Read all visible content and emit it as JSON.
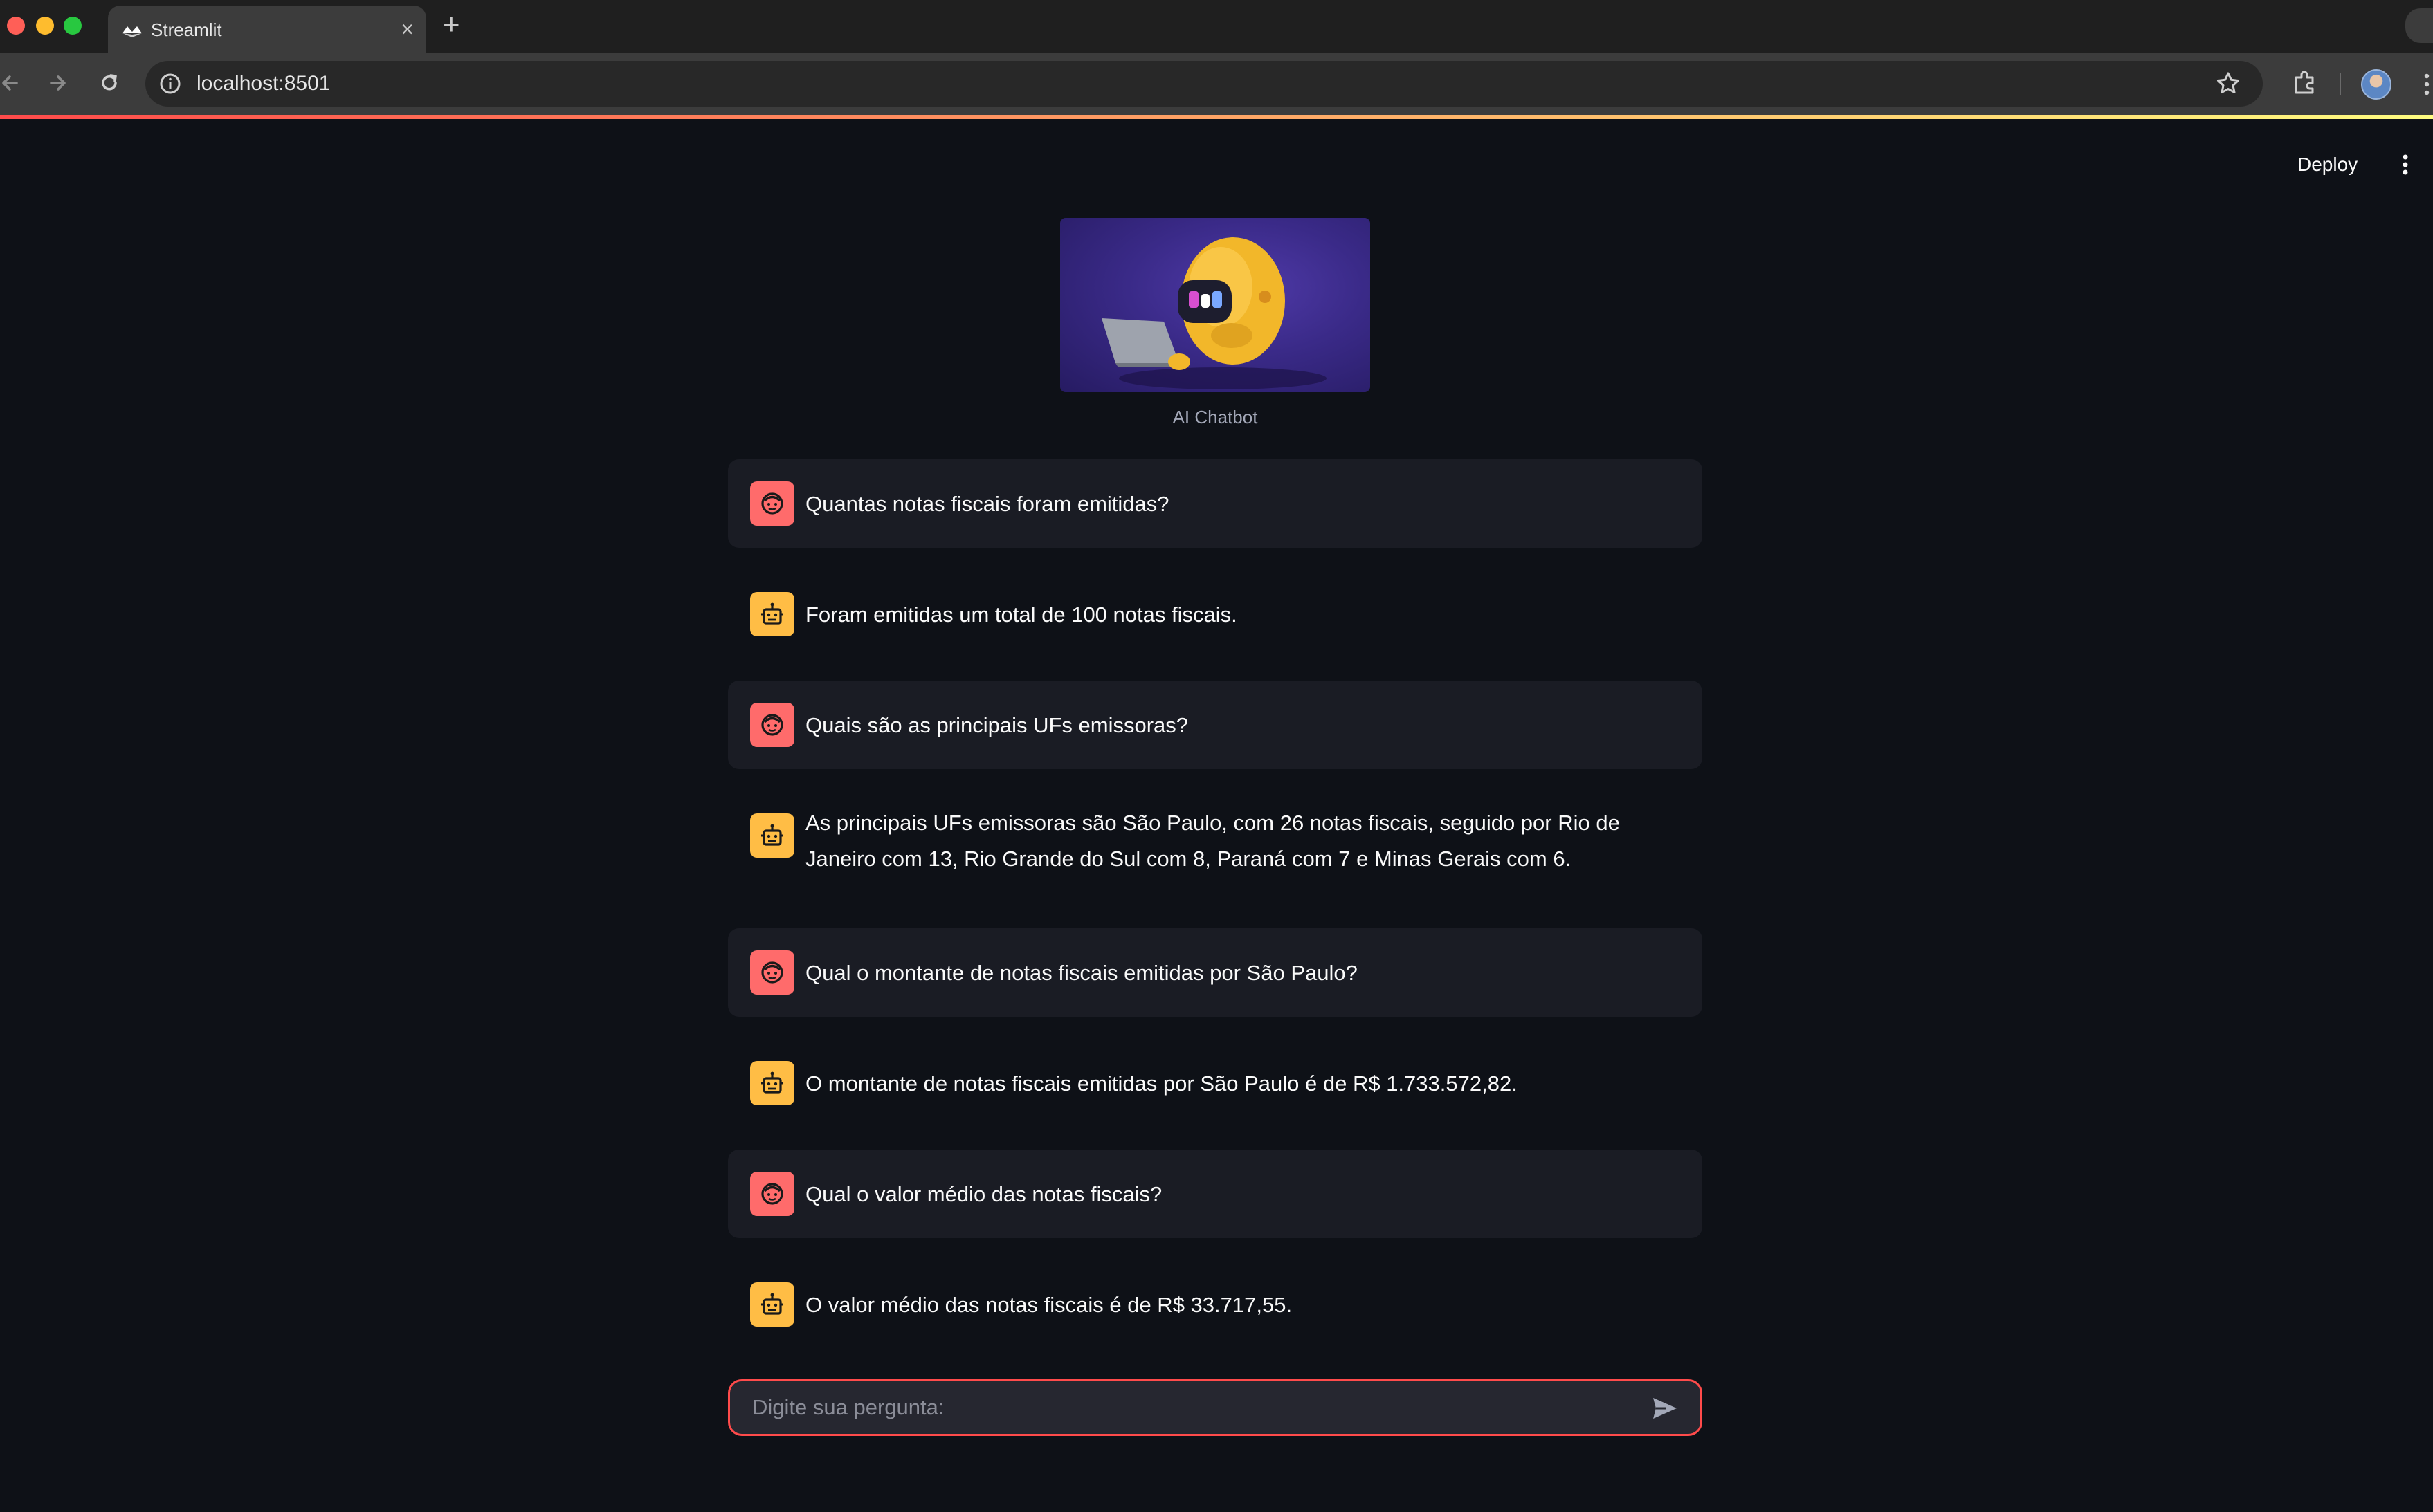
{
  "browser": {
    "tab_title": "Streamlit",
    "tab_close": "×",
    "new_tab": "+",
    "url": "localhost:8501"
  },
  "app": {
    "deploy_label": "Deploy",
    "hero_caption": "AI Chatbot",
    "input_placeholder": "Digite sua pergunta:"
  },
  "messages": [
    {
      "role": "user",
      "text": "Quantas notas fiscais foram emitidas?"
    },
    {
      "role": "assistant",
      "text": "Foram emitidas um total de 100 notas fiscais."
    },
    {
      "role": "user",
      "text": "Quais são as principais UFs emissoras?"
    },
    {
      "role": "assistant",
      "text": "As principais UFs emissoras são São Paulo, com 26 notas fiscais, seguido por Rio de Janeiro com 13, Rio Grande do Sul com 8, Paraná com 7 e Minas Gerais com 6."
    },
    {
      "role": "user",
      "text": "Qual o montante de notas fiscais emitidas por São Paulo?"
    },
    {
      "role": "assistant",
      "text": "O montante de notas fiscais emitidas por São Paulo é de R$ 1.733.572,82."
    },
    {
      "role": "user",
      "text": "Qual o valor médio das notas fiscais?"
    },
    {
      "role": "assistant",
      "text": "O valor médio das notas fiscais é de R$ 33.717,55."
    }
  ],
  "colors": {
    "user_avatar": "#ff6b6b",
    "assistant_avatar": "#ffbd45",
    "input_border": "#ff4b4b",
    "background": "#0e1117"
  },
  "icons": {
    "user_avatar": "user-face-icon",
    "assistant_avatar": "robot-icon",
    "send": "send-icon"
  }
}
